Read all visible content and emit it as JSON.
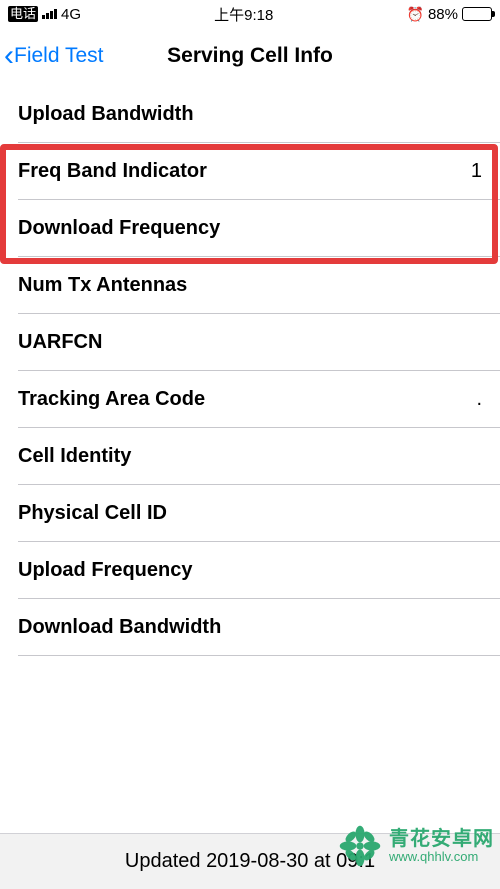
{
  "status": {
    "carrier": "电话",
    "network": "4G",
    "time": "上午9:18",
    "battery_pct": "88%"
  },
  "nav": {
    "back_label": "Field Test",
    "title": "Serving Cell Info"
  },
  "rows": [
    {
      "label": "Upload Bandwidth",
      "value": ""
    },
    {
      "label": "Freq Band Indicator",
      "value": "1"
    },
    {
      "label": "Download Frequency",
      "value": ""
    },
    {
      "label": "Num Tx Antennas",
      "value": ""
    },
    {
      "label": "UARFCN",
      "value": ""
    },
    {
      "label": "Tracking Area Code",
      "value": "."
    },
    {
      "label": "Cell Identity",
      "value": ""
    },
    {
      "label": "Physical Cell ID",
      "value": ""
    },
    {
      "label": "Upload Frequency",
      "value": ""
    },
    {
      "label": "Download Bandwidth",
      "value": ""
    }
  ],
  "footer": {
    "updated": "Updated 2019-08-30 at 09:1"
  },
  "watermark": {
    "cn": "青花安卓网",
    "url": "www.qhhlv.com"
  }
}
